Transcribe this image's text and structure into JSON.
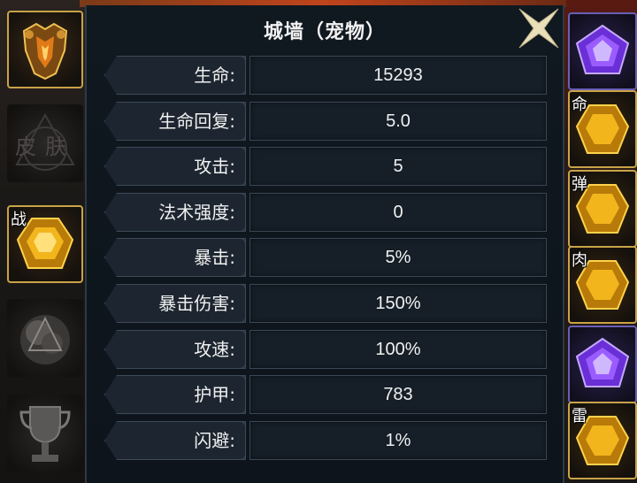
{
  "panel": {
    "title": "城墙（宠物）",
    "close_icon": "close-x-icon"
  },
  "stats": [
    {
      "label": "生命:",
      "value": "15293"
    },
    {
      "label": "生命回复:",
      "value": "5.0"
    },
    {
      "label": "攻击:",
      "value": "5"
    },
    {
      "label": "法术强度:",
      "value": "0"
    },
    {
      "label": "暴击:",
      "value": "5%"
    },
    {
      "label": "暴击伤害:",
      "value": "150%"
    },
    {
      "label": "攻速:",
      "value": "100%"
    },
    {
      "label": "护甲:",
      "value": "783"
    },
    {
      "label": "闪避:",
      "value": "1%"
    }
  ],
  "left_slots": [
    {
      "icon": "golden-armor-icon",
      "tag": ""
    },
    {
      "icon": "skin-emblem-icon",
      "tag": "",
      "text": "皮肤"
    },
    {
      "icon": "gold-gem-icon",
      "tag": "战"
    },
    {
      "icon": "gray-smoke-icon",
      "tag": ""
    },
    {
      "icon": "trophy-icon",
      "tag": ""
    }
  ],
  "right_slots": [
    {
      "icon": "purple-gem-icon",
      "tag": ""
    },
    {
      "icon": "gold-gem-icon",
      "tag": "命"
    },
    {
      "icon": "gold-gem-icon",
      "tag": "弹"
    },
    {
      "icon": "gold-gem-icon",
      "tag": "肉"
    },
    {
      "icon": "purple-gem-icon",
      "tag": ""
    },
    {
      "icon": "gold-gem-icon",
      "tag": "雷"
    }
  ],
  "colors": {
    "panel_bg": "#101820",
    "gold_border": "#c9a347",
    "text": "#f0f0f0"
  }
}
